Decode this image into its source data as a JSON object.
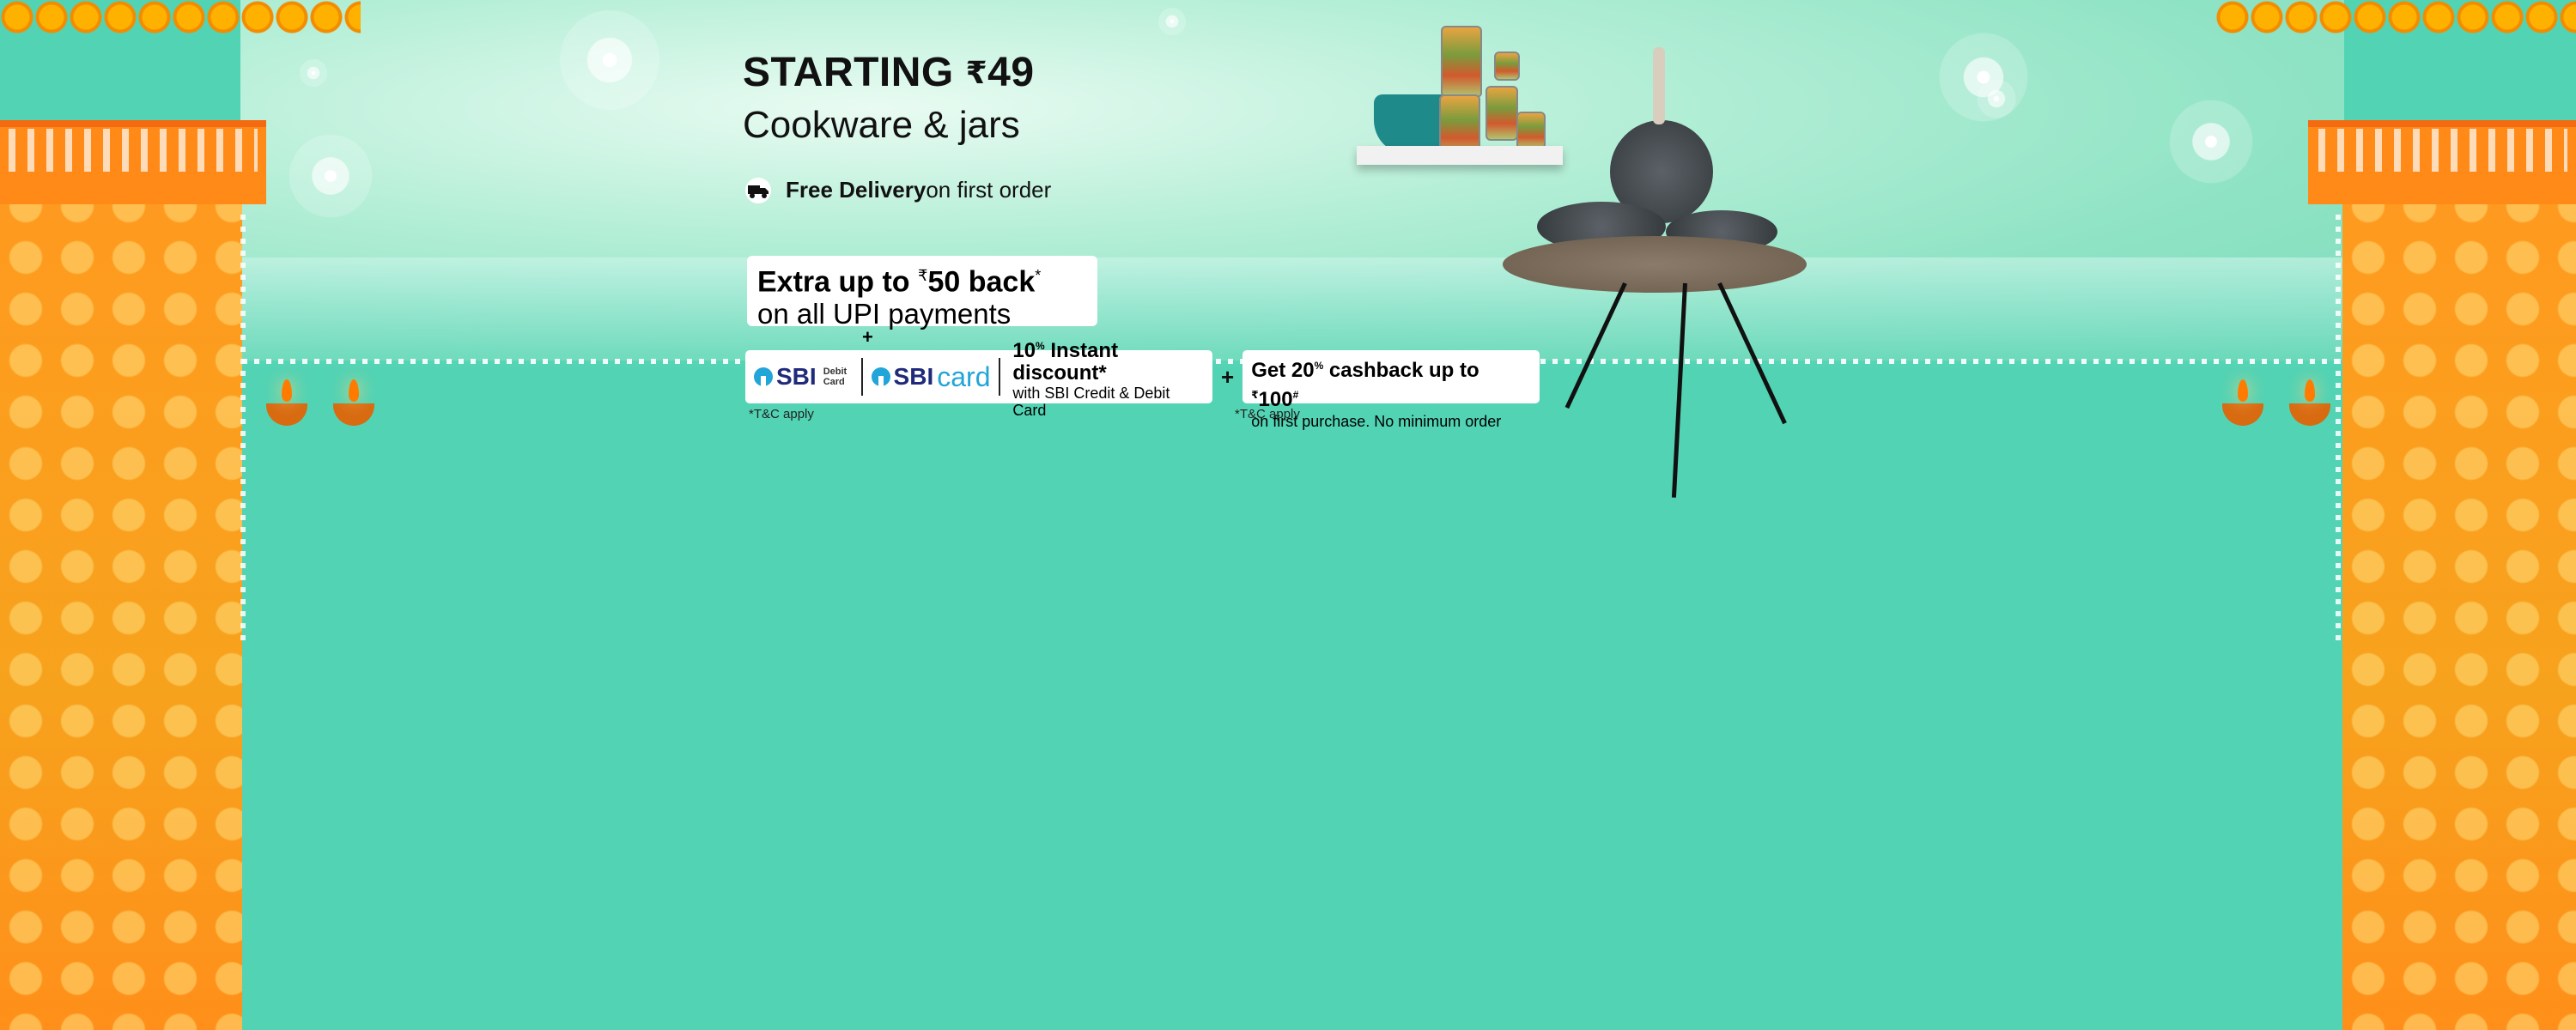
{
  "promo": {
    "headline_prefix": "STARTING ",
    "headline_currency": "₹",
    "headline_amount": "49",
    "subhead": "Cookware & jars",
    "delivery_bold": "Free Delivery",
    "delivery_rest": " on first order",
    "upi_line1_prefix": "Extra up to ",
    "upi_line1_currency": "₹",
    "upi_line1_amount": "50 back",
    "upi_line1_asterisk": "*",
    "upi_line2": "on all UPI payments",
    "plus_symbol": "+"
  },
  "bank_offer": {
    "sbi_logo_text": "SBI",
    "debit_card_label": "Debit Card",
    "sbi_card_text": "SBI",
    "card_word": "card",
    "discount_big": "10",
    "discount_percent": "%",
    "discount_text": " Instant discount*",
    "discount_sub": "with SBI Credit & Debit Card",
    "plus_symbol": "+",
    "tnc": "*T&C apply"
  },
  "cashback_offer": {
    "line1_prefix": "Get 20",
    "line1_percent": "%",
    "line1_mid": " cashback up to ",
    "line1_currency": "₹",
    "line1_amount": "100",
    "line1_hash": "#",
    "line2": "on first purchase. No minimum order",
    "tnc": "*T&C apply"
  },
  "icons": [
    "truck-icon",
    "diya-icon",
    "firework-icon",
    "marigold-garland-icon"
  ],
  "colors": {
    "background": "#52d3b4",
    "pillar_orange": "#ff9a1f",
    "sbi_blue": "#1f2a7a",
    "sbi_light_blue": "#22a5d8"
  }
}
